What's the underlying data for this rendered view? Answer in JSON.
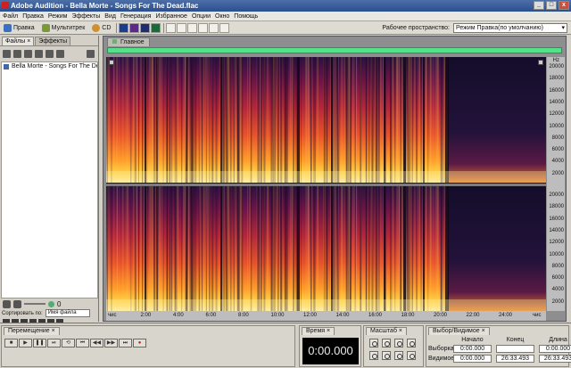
{
  "window": {
    "title": "Adobe Audition - Bella Morte - Songs For The Dead.flac",
    "controls": [
      "_",
      "□",
      "x"
    ]
  },
  "menu": [
    "Файл",
    "Правка",
    "Режим",
    "Эффекты",
    "Вид",
    "Генерация",
    "Избранное",
    "Опции",
    "Окно",
    "Помощь"
  ],
  "toolbar": {
    "modes": [
      {
        "label": "Правка",
        "icon": "waveform-edit-icon",
        "color": "#3c6fbd"
      },
      {
        "label": "Мультитрек",
        "icon": "multitrack-icon",
        "color": "#7a9a3a"
      },
      {
        "label": "CD",
        "icon": "cd-icon",
        "color": "#d09030"
      }
    ],
    "workspace_label": "Рабочее пространство:",
    "workspace_value": "Режим Правка(по умолчанию)"
  },
  "left_panel": {
    "tabs": [
      {
        "label": "Файлы",
        "close": "×"
      },
      {
        "label": "Эффекты",
        "close": ""
      }
    ],
    "files": [
      "Bella Morte - Songs For The Dead"
    ],
    "volume_value": "0",
    "sort_label": "Сортировать по:",
    "sort_value": "Имя файла"
  },
  "editor": {
    "tab_label": "Главное",
    "hz_unit": "Hz",
    "hz_labels": [
      "20000",
      "18000",
      "16000",
      "14000",
      "12000",
      "10000",
      "8000",
      "6000",
      "4000",
      "2000"
    ],
    "time_labels": [
      "чис",
      "2:00",
      "4:00",
      "6:00",
      "8:00",
      "10:00",
      "12:00",
      "14:00",
      "16:00",
      "18:00",
      "20:00",
      "22:00",
      "24:00",
      "чис"
    ],
    "total_duration": "26:33.493"
  },
  "transport": {
    "tab_label": "Перемещение",
    "close": "×",
    "buttons": [
      "■",
      "▶",
      "❚❚",
      "⏯",
      "⟲",
      "⏮",
      "◀◀",
      "▶▶",
      "⏭",
      "●"
    ]
  },
  "time_panel": {
    "tab_label": "Время",
    "close": "×",
    "value": "0:00.000"
  },
  "zoom_panel": {
    "tab_label": "Масштаб",
    "close": "×"
  },
  "selection_panel": {
    "tab_label": "Выбор/Видимое",
    "close": "×",
    "columns": [
      "Начало",
      "Конец",
      "Длина"
    ],
    "rows": [
      {
        "label": "Выборка",
        "values": [
          "0:00.000",
          "",
          "0:00.000"
        ]
      },
      {
        "label": "Видимое",
        "values": [
          "0:00.000",
          "26:33.493",
          "26:33.493"
        ]
      }
    ]
  },
  "colors": {
    "overview_bar": "#55e08a",
    "spectrum_low": "#141426",
    "spectrum_high": "#ffd54a"
  }
}
